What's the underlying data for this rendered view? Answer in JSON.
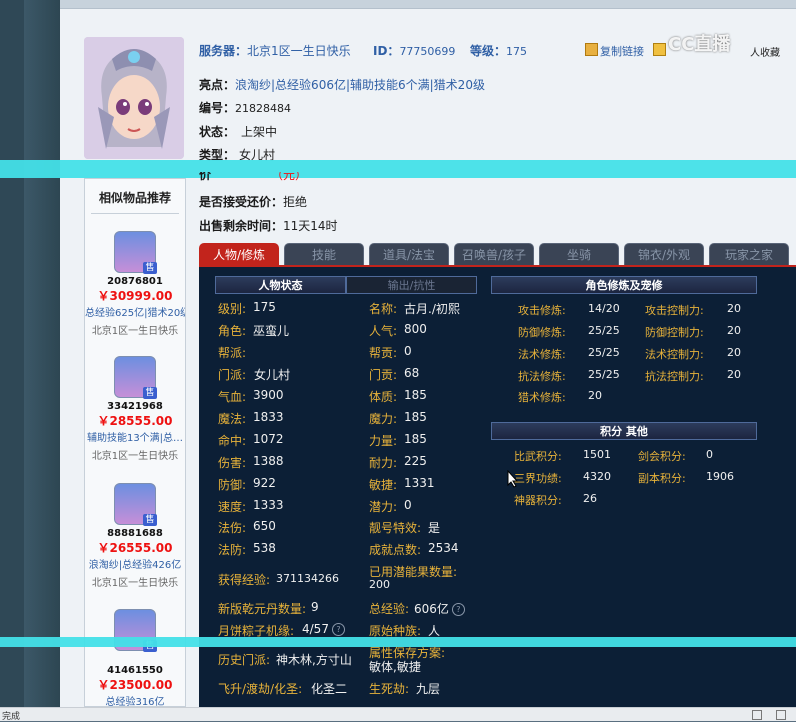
{
  "header": {
    "server_label": "服务器：",
    "server_value": "北京1区一生日快乐",
    "id_label": "ID：",
    "id_value": "77750699",
    "level_label": "等级：",
    "level_value": "175",
    "copy_link": "复制链接",
    "watermark": "CC直播",
    "fav_text": "人收藏"
  },
  "info": {
    "highlight_label": "亮点：",
    "highlight_value": "浪淘纱|总经验606亿|辅助技能6个满|猎术20级",
    "number_label": "编号：",
    "number_value": "21828484",
    "status_label": "状态：",
    "status_value": "上架中",
    "type_label": "类型：",
    "type_value": "女儿村",
    "price_label": "价",
    "price_value": "（元）",
    "bargain_label": "是否接受还价：",
    "bargain_value": "拒绝",
    "remain_label": "出售剩余时间：",
    "remain_value": "11天14时"
  },
  "recommend": {
    "title": "相似物品推荐",
    "items": [
      {
        "id": "20876801",
        "price": "￥30999.00",
        "desc": "总经验625亿|猎术20级",
        "server": "北京1区一生日快乐"
      },
      {
        "id": "33421968",
        "price": "￥28555.00",
        "desc": "辅助技能13个满|总…",
        "server": "北京1区一生日快乐"
      },
      {
        "id": "88881688",
        "price": "￥26555.00",
        "desc": "浪淘纱|总经验426亿",
        "server": "北京1区一生日快乐"
      },
      {
        "id": "41461550",
        "price": "￥23500.00",
        "desc": "总经验316亿",
        "server": ""
      }
    ],
    "sell_badge": "售"
  },
  "tabs": [
    "人物/修炼",
    "技能",
    "道具/法宝",
    "召唤兽/孩子",
    "坐骑",
    "锦衣/外观",
    "玩家之家"
  ],
  "panel": {
    "head_status": "人物状态",
    "head_output": "输出/抗性",
    "head_cultivation": "角色修炼及宠修",
    "head_points": "积分 其他",
    "left_col": [
      {
        "label": "级别:",
        "value": "175"
      },
      {
        "label": "角色:",
        "value": "巫蛮儿"
      },
      {
        "label": "帮派:",
        "value": ""
      },
      {
        "label": "门派:",
        "value": "女儿村"
      },
      {
        "label": "气血:",
        "value": "3900"
      },
      {
        "label": "魔法:",
        "value": "1833"
      },
      {
        "label": "命中:",
        "value": "1072"
      },
      {
        "label": "伤害:",
        "value": "1388"
      },
      {
        "label": "防御:",
        "value": "922"
      },
      {
        "label": "速度:",
        "value": "1333"
      },
      {
        "label": "法伤:",
        "value": "650"
      },
      {
        "label": "法防:",
        "value": "538"
      }
    ],
    "right_col": [
      {
        "label": "名称:",
        "value": "古月./初熙"
      },
      {
        "label": "人气:",
        "value": "800"
      },
      {
        "label": "帮贡:",
        "value": "0"
      },
      {
        "label": "门贡:",
        "value": "68"
      },
      {
        "label": "体质:",
        "value": "185"
      },
      {
        "label": "魔力:",
        "value": "185"
      },
      {
        "label": "力量:",
        "value": "185"
      },
      {
        "label": "耐力:",
        "value": "225"
      },
      {
        "label": "敏捷:",
        "value": "1331"
      },
      {
        "label": "潜力:",
        "value": "0"
      },
      {
        "label": "靓号特效:",
        "value": "是"
      },
      {
        "label": "成就点数:",
        "value": "2534"
      }
    ],
    "exp_label": "获得经验:",
    "exp_value": "371134266",
    "used_label": "已用潜能果数量:",
    "used_value": "200",
    "qianyuan_label": "新版乾元丹数量:",
    "qianyuan_value": "9",
    "total_exp_label": "总经验:",
    "total_exp_value": "606亿",
    "zongzi_label": "月饼粽子机缘:",
    "zongzi_value": "4/57",
    "race_label": "原始种族:",
    "race_value": "人",
    "history_label": "历史门派:",
    "history_value": "神木林,方寸山",
    "attr_label": "属性保存方案:",
    "attr_value": "敏体,敏捷",
    "feisheng_label": "飞升/渡劫/化圣:",
    "feisheng_value": "化圣二",
    "shengsi_label": "生死劫:",
    "shengsi_value": "九层",
    "cultivation": [
      {
        "label": "攻击修炼:",
        "value": "14/20",
        "label2": "攻击控制力:",
        "value2": "20"
      },
      {
        "label": "防御修炼:",
        "value": "25/25",
        "label2": "防御控制力:",
        "value2": "20"
      },
      {
        "label": "法术修炼:",
        "value": "25/25",
        "label2": "法术控制力:",
        "value2": "20"
      },
      {
        "label": "抗法修炼:",
        "value": "25/25",
        "label2": "抗法控制力:",
        "value2": "20"
      },
      {
        "label": "猎术修炼:",
        "value": "20",
        "label2": "",
        "value2": ""
      }
    ],
    "points": [
      {
        "label": "比武积分:",
        "value": "1501",
        "label2": "剑会积分:",
        "value2": "0"
      },
      {
        "label": "三界功绩:",
        "value": "4320",
        "label2": "副本积分:",
        "value2": "1906"
      },
      {
        "label": "神器积分:",
        "value": "26",
        "label2": "",
        "value2": ""
      }
    ],
    "help": "?"
  },
  "statusbar": {
    "text": "完成"
  }
}
